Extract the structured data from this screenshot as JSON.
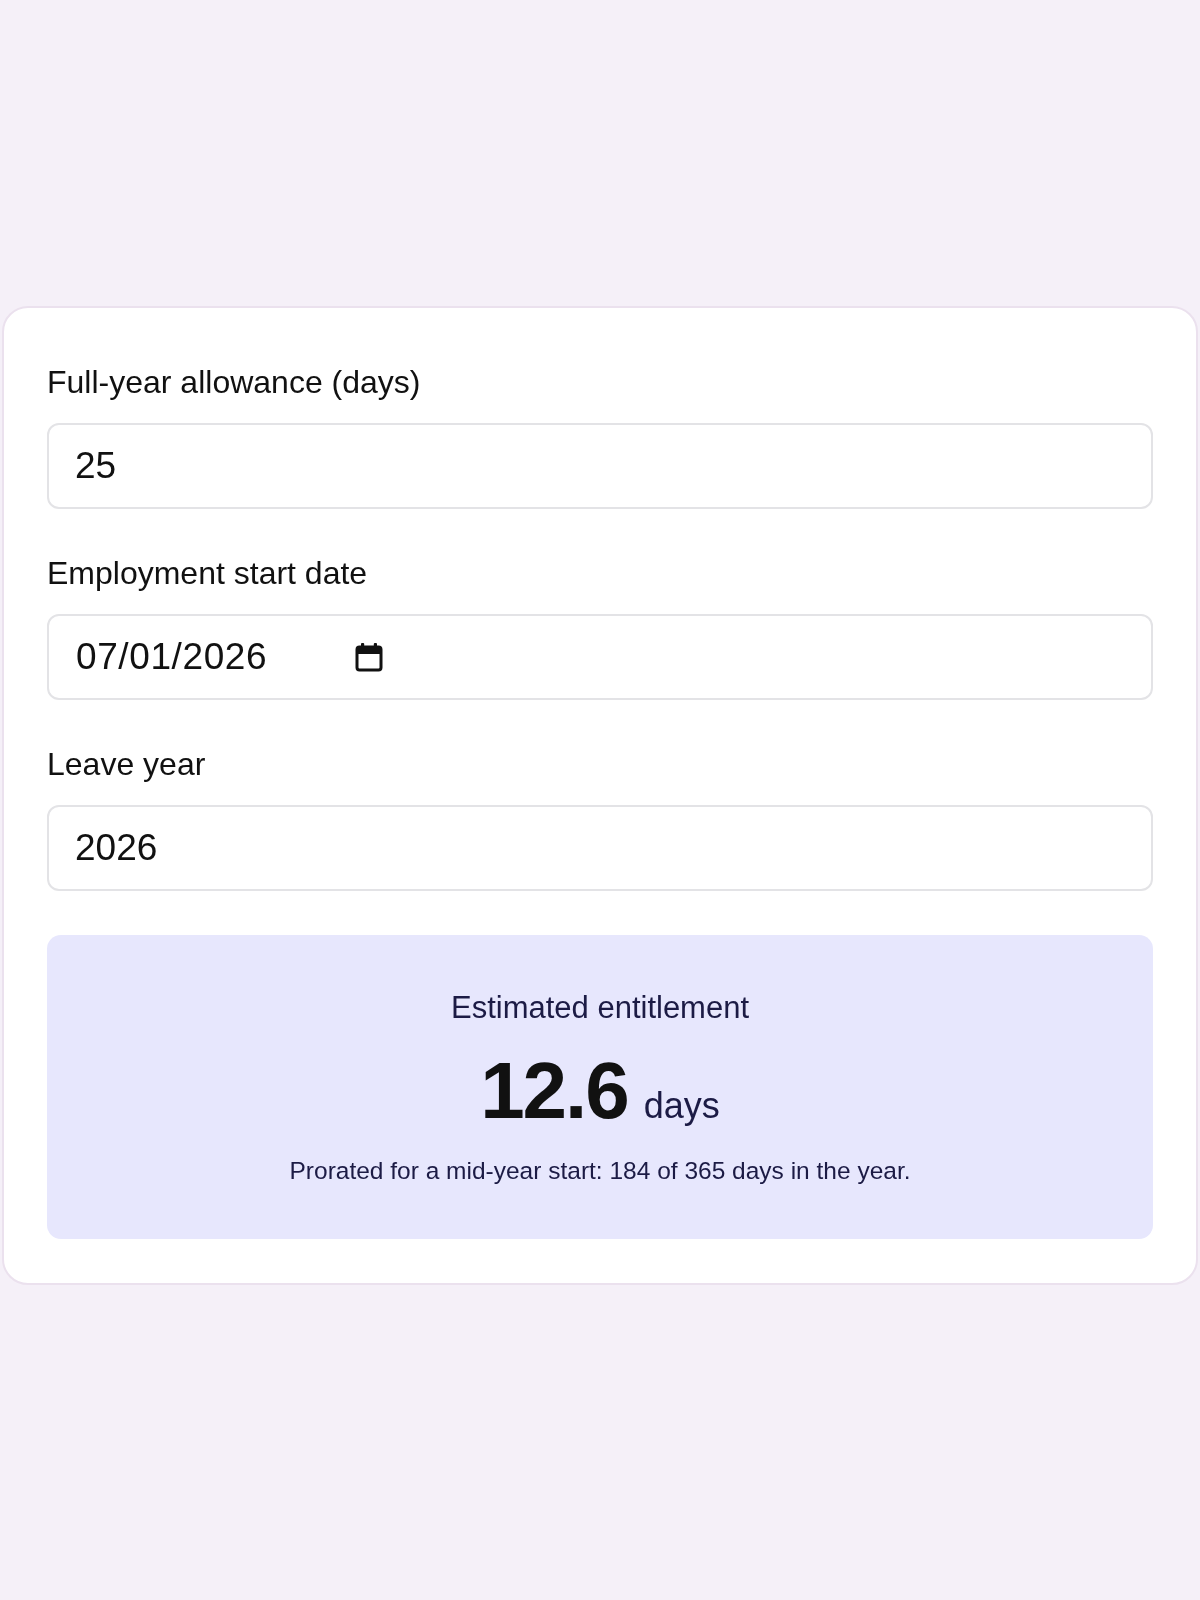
{
  "form": {
    "fields": [
      {
        "kind": "number",
        "label": "Full-year allowance (days)",
        "value": "25"
      },
      {
        "kind": "date",
        "label": "Employment start date",
        "value": "07/01/2026"
      },
      {
        "kind": "number",
        "label": "Leave year",
        "value": "2026"
      }
    ]
  },
  "result": {
    "title": "Estimated entitlement",
    "amount": "12.6",
    "unit": "days",
    "note": "Prorated for a mid-year start: 184 of 365 days in the year."
  }
}
